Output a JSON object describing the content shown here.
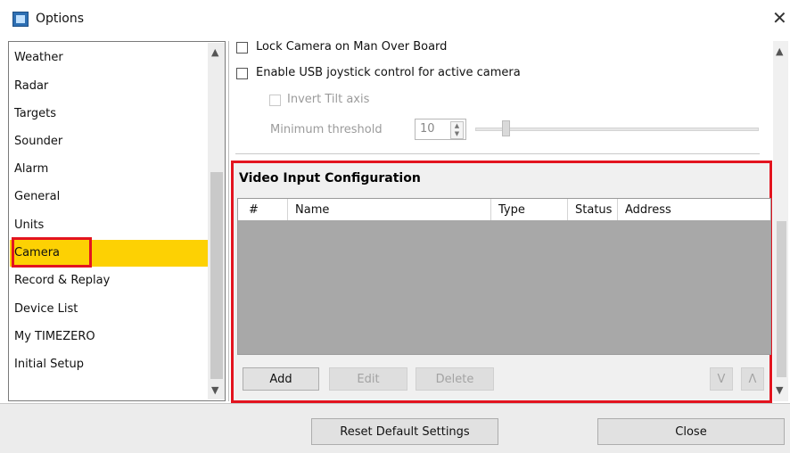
{
  "window": {
    "title": "Options",
    "close_glyph": "✕"
  },
  "nav": {
    "items": [
      {
        "label": "Weather"
      },
      {
        "label": "Radar"
      },
      {
        "label": "Targets"
      },
      {
        "label": "Sounder"
      },
      {
        "label": "Alarm"
      },
      {
        "label": "General"
      },
      {
        "label": "Units"
      },
      {
        "label": "Camera"
      },
      {
        "label": "Record & Replay"
      },
      {
        "label": "Device List"
      },
      {
        "label": "My TIMEZERO"
      },
      {
        "label": "Initial Setup"
      }
    ],
    "selected": "Camera",
    "scroll_up": "▲",
    "scroll_down": "▼"
  },
  "camera": {
    "lock_on_mob": "Lock Camera on Man Over Board",
    "usb_joystick": "Enable USB joystick control for active camera",
    "invert_tilt": "Invert Tilt axis",
    "min_threshold_label": "Minimum threshold",
    "min_threshold_value": "10"
  },
  "video_input": {
    "title": "Video Input Configuration",
    "columns": [
      "#",
      "Name",
      "Type",
      "Status",
      "Address"
    ],
    "rows": [],
    "buttons": {
      "add": "Add",
      "edit": "Edit",
      "delete": "Delete",
      "move_down": "V",
      "move_up": "Λ"
    }
  },
  "footer": {
    "reset_label": "Reset Default Settings",
    "close_label": "Close"
  },
  "colors": {
    "selected_bg": "#fdd103",
    "highlight_border": "#e3141f",
    "grid_empty": "#a8a8a8"
  }
}
